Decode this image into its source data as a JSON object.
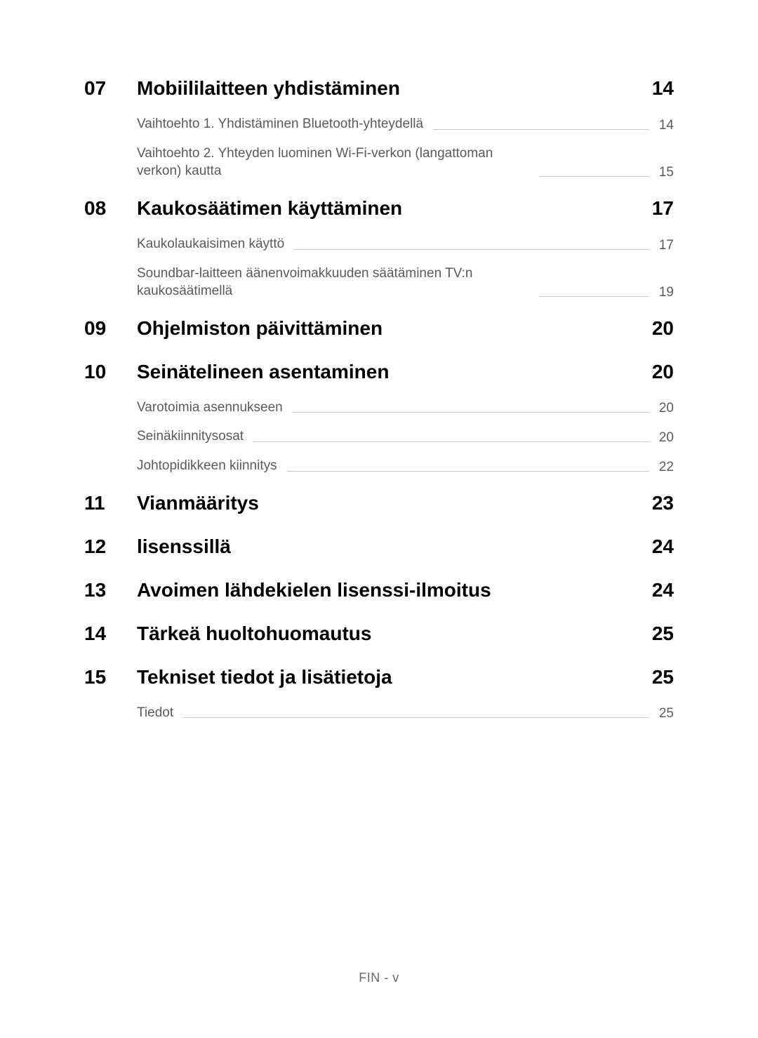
{
  "sections": [
    {
      "number": "07",
      "title": "Mobiililaitteen yhdistäminen",
      "page": "14",
      "subs": [
        {
          "title": "Vaihtoehto 1. Yhdistäminen Bluetooth-yhteydellä",
          "page": "14"
        },
        {
          "title": "Vaihtoehto 2. Yhteyden luominen Wi-Fi-verkon (langattoman verkon) kautta",
          "page": "15"
        }
      ]
    },
    {
      "number": "08",
      "title": "Kaukosäätimen käyttäminen",
      "page": "17",
      "subs": [
        {
          "title": "Kaukolaukaisimen käyttö",
          "page": "17"
        },
        {
          "title": "Soundbar-laitteen äänenvoimakkuuden säätäminen TV:n kaukosäätimellä",
          "page": "19"
        }
      ]
    },
    {
      "number": "09",
      "title": "Ohjelmiston päivittäminen",
      "page": "20",
      "subs": []
    },
    {
      "number": "10",
      "title": "Seinätelineen asentaminen",
      "page": "20",
      "subs": [
        {
          "title": "Varotoimia asennukseen",
          "page": "20"
        },
        {
          "title": "Seinäkiinnitysosat",
          "page": "20"
        },
        {
          "title": "Johtopidikkeen kiinnitys",
          "page": "22"
        }
      ]
    },
    {
      "number": "11",
      "title": "Vianmääritys",
      "page": "23",
      "subs": []
    },
    {
      "number": "12",
      "title": "lisenssillä",
      "page": "24",
      "subs": []
    },
    {
      "number": "13",
      "title": "Avoimen lähdekielen lisenssi-ilmoitus",
      "page": "24",
      "subs": []
    },
    {
      "number": "14",
      "title": "Tärkeä huoltohuomautus",
      "page": "25",
      "subs": []
    },
    {
      "number": "15",
      "title": "Tekniset tiedot ja lisätietoja",
      "page": "25",
      "subs": [
        {
          "title": "Tiedot",
          "page": "25"
        }
      ]
    }
  ],
  "footer": "FIN - v"
}
